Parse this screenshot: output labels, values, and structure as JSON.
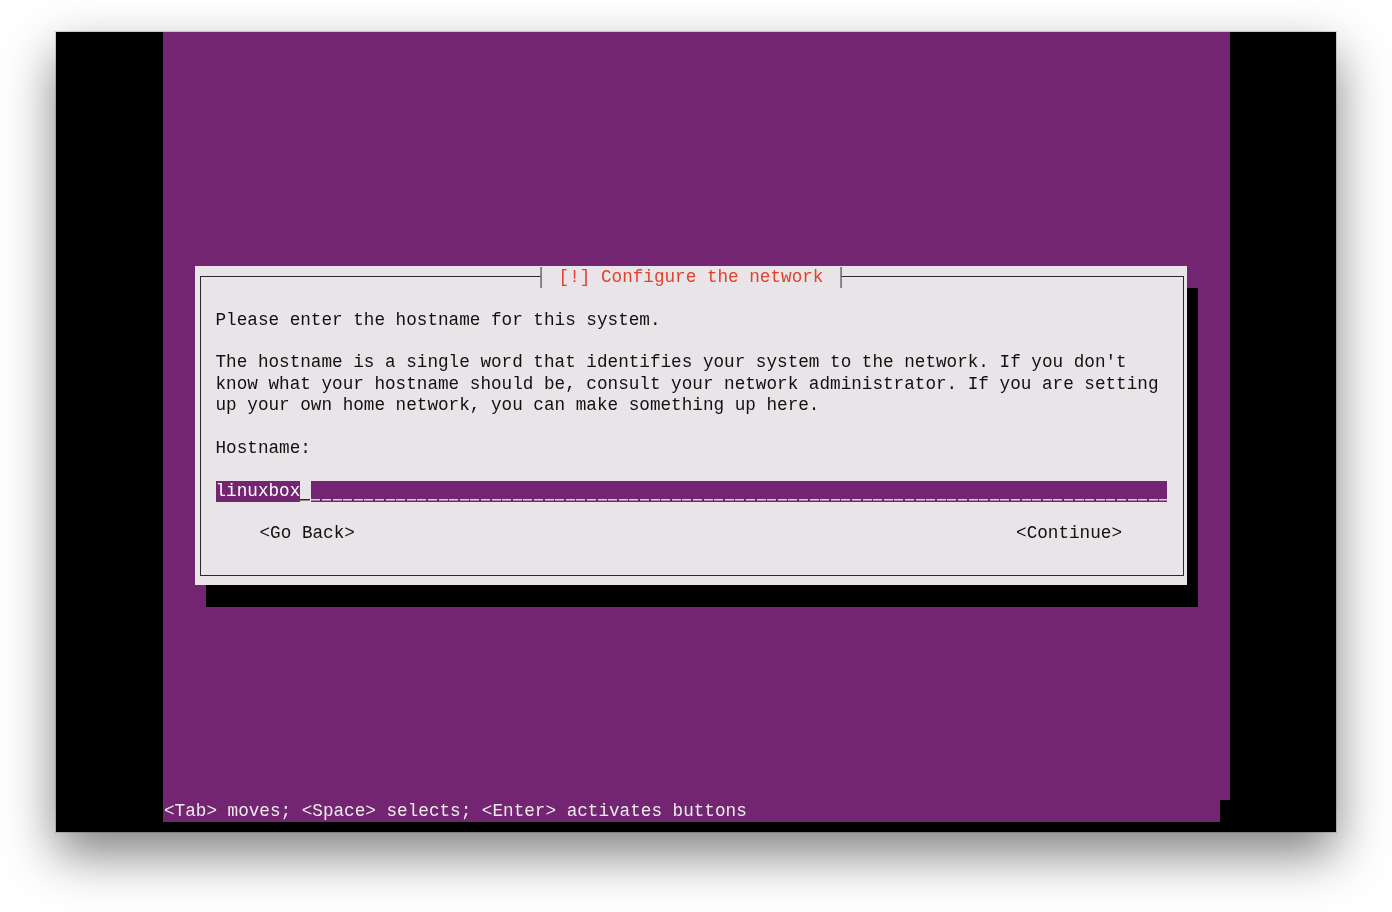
{
  "dialog": {
    "title": "[!] Configure the network",
    "paragraphs": [
      "Please enter the hostname for this system.",
      "The hostname is a single word that identifies your system to the network. If you don't know what your hostname should be, consult your network administrator. If you are setting up your own home network, you can make something up here."
    ],
    "field": {
      "label": "Hostname:",
      "value": "linuxbox",
      "focused": true
    },
    "buttons": [
      "<Go Back>",
      "<Continue>"
    ]
  },
  "status_bar": "<Tab> moves; <Space> selects; <Enter> activates buttons"
}
